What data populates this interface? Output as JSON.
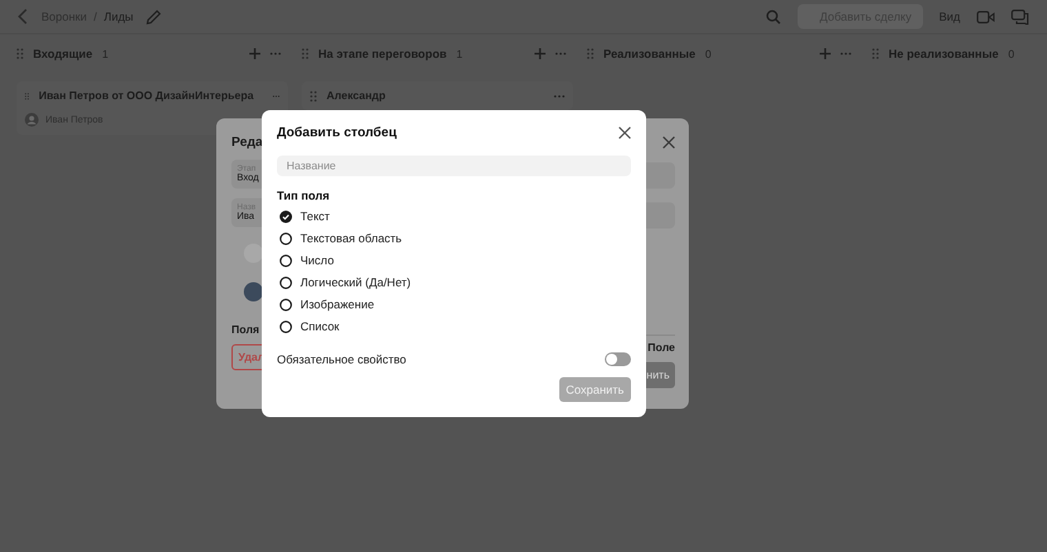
{
  "breadcrumb": [
    "Воронки",
    "Лиды"
  ],
  "breadcrumb_separator": "/",
  "toolbar": {
    "add_button": "Добавить сделку",
    "view": "Вид"
  },
  "columns": [
    {
      "title": "Входящие",
      "count": "1",
      "actions": true,
      "cards": [
        {
          "title": "Иван Петров от ООО ДизайнИнтерьера",
          "owner": "Иван Петров"
        }
      ]
    },
    {
      "title": "На этапе переговоров",
      "count": "1",
      "actions": true,
      "cards": [
        {
          "title": "Александр"
        }
      ]
    },
    {
      "title": "Реализованные",
      "count": "0",
      "actions": true
    },
    {
      "title": "Не реализованные",
      "count": "0",
      "actions": false
    }
  ],
  "edit_dialog": {
    "title": "Реда",
    "fields": [
      {
        "label": "Этап",
        "value": "Вход"
      },
      {
        "label": "Назв",
        "value": "Ива"
      }
    ],
    "section": "Поля",
    "delete_button": "Удал",
    "right_label": "Поле",
    "save_button": "нить"
  },
  "add_column_dialog": {
    "title": "Добавить столбец",
    "name_placeholder": "Название",
    "type_label": "Тип поля",
    "types": [
      {
        "label": "Текст",
        "selected": true
      },
      {
        "label": "Текстовая область",
        "selected": false
      },
      {
        "label": "Число",
        "selected": false
      },
      {
        "label": "Логический (Да/Нет)",
        "selected": false
      },
      {
        "label": "Изображение",
        "selected": false
      },
      {
        "label": "Список",
        "selected": false
      }
    ],
    "required": {
      "label": "Обязательное свойство",
      "on": false
    },
    "save_button": {
      "label": "Сохранить",
      "disabled": true
    }
  }
}
